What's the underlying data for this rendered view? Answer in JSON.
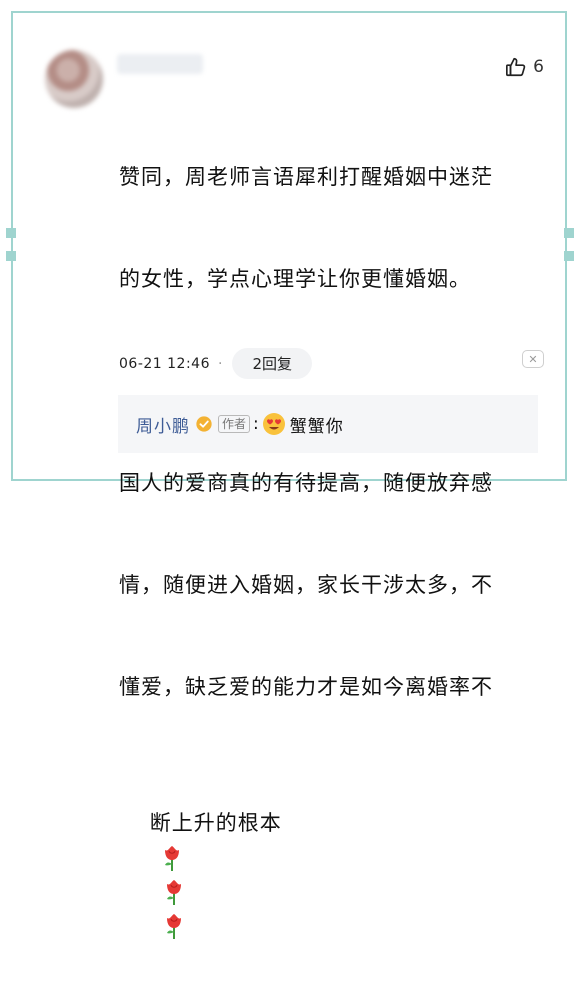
{
  "comment": {
    "like_count": "6",
    "lines": [
      "赞同，周老师言语犀利打醒婚姻中迷茫",
      "的女性，学点心理学让你更懂婚姻。"
    ],
    "body_lines": [
      "国人的爱商真的有待提高，随便放弃感",
      "情，随便进入婚姻，家长干涉太多，不",
      "懂爱，缺乏爱的能力才是如今离婚率不",
      "断上升的根本"
    ],
    "time": "06-21 12:46",
    "dot": "·",
    "reply_count_label": "2回复",
    "close_symbol": "✕"
  },
  "reply": {
    "author": "周小鹏",
    "author_badge": "作者",
    "colon": ":",
    "text": "蟹蟹你"
  },
  "icons": {
    "like": "thumbs-up-icon",
    "thumbs_emoji": "thumbs-up-emoji",
    "rose": "rose-emoji",
    "verified": "verified-badge-icon",
    "heart_eyes": "heart-eyes-emoji"
  },
  "colors": {
    "frame": "#9fd4cf",
    "author_blue": "#3e5c96",
    "reply_bg": "#f5f6f8",
    "verified_yellow": "#f3b233"
  }
}
